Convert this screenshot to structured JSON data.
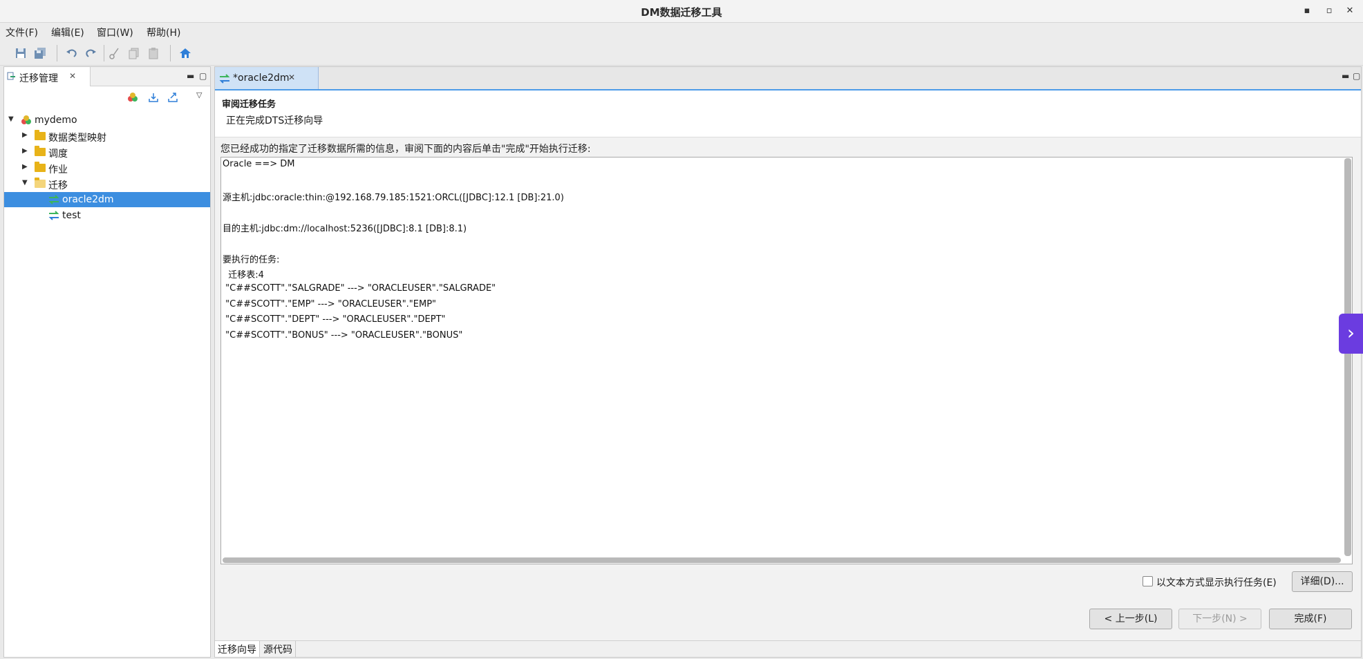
{
  "window": {
    "title": "DM数据迁移工具",
    "minimize": "▪",
    "maximize": "▫",
    "close": "✕"
  },
  "menu": [
    "文件(F)",
    "编辑(E)",
    "窗口(W)",
    "帮助(H)"
  ],
  "toolbar": {
    "icons": [
      "save-icon",
      "save-all-icon",
      "undo-icon",
      "redo-icon",
      "cut-icon",
      "copy-icon",
      "paste-icon",
      "home-icon"
    ]
  },
  "left_panel": {
    "tab_label": "迁移管理",
    "tree": {
      "root": "mydemo",
      "children": [
        "数据类型映射",
        "调度",
        "作业",
        "迁移"
      ],
      "migrations": [
        "oracle2dm",
        "test"
      ]
    }
  },
  "editor": {
    "tab_label": "*oracle2dm",
    "header_title": "审阅迁移任务",
    "header_subtitle": "正在完成DTS迁移向导",
    "description": "您已经成功的指定了迁移数据所需的信息，审阅下面的内容后单击\"完成\"开始执行迁移:",
    "lines": [
      "Oracle ==> DM",
      "源主机:jdbc:oracle:thin:@192.168.79.185:1521:ORCL([JDBC]:12.1 [DB]:21.0)",
      "目的主机:jdbc:dm://localhost:5236([JDBC]:8.1 [DB]:8.1)",
      "要执行的任务:",
      "  迁移表:4",
      " \"C##SCOTT\".\"SALGRADE\" ---> \"ORACLEUSER\".\"SALGRADE\"",
      " \"C##SCOTT\".\"EMP\" ---> \"ORACLEUSER\".\"EMP\"",
      " \"C##SCOTT\".\"DEPT\" ---> \"ORACLEUSER\".\"DEPT\"",
      " \"C##SCOTT\".\"BONUS\" ---> \"ORACLEUSER\".\"BONUS\""
    ],
    "checkbox_label": "以文本方式显示执行任务(E)",
    "details_button": "详细(D)...",
    "prev_button": "< 上一步(L)",
    "next_button": "下一步(N) >",
    "finish_button": "完成(F)",
    "bottom_tabs": [
      "迁移向导",
      "源代码"
    ]
  },
  "colors": {
    "selection": "#3c8ee0",
    "accent": "#4c9be8",
    "side_handle": "#6b3ce0"
  }
}
